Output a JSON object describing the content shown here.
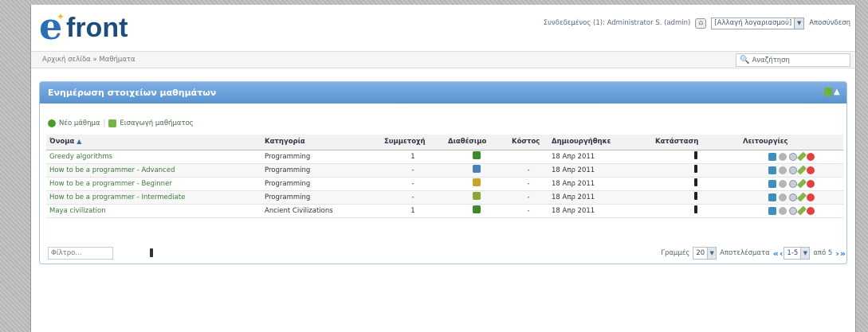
{
  "header": {
    "logo": "efront",
    "user": {
      "connected_label": "Συνδεδεμένος (1): Administrator S. (admin)",
      "role_switch": "[Αλλαγή λογαριασμού]",
      "logout": "Αποσύνδεση"
    }
  },
  "nav": {
    "breadcrumb": "Αρχική σελίδα » Μαθήματα",
    "search_placeholder": "Αναζήτηση"
  },
  "panel": {
    "title": "Ενημέρωση στοιχείων μαθημάτων",
    "toolbar": {
      "new_course": "Νέο μάθημα",
      "import_course": "Εισαγωγή μαθήματος"
    },
    "columns": [
      "Όνομα",
      "Κατηγορία",
      "Συμμετοχή",
      "Διαθέσιμο",
      "Κόστος",
      "Δημιουργήθηκε",
      "Κατάσταση",
      "Λειτουργίες"
    ],
    "rows": [
      {
        "name": "Greedy algorithms",
        "category": "Programming",
        "participation": "1",
        "available_color": "#3c8a2a",
        "cost": "",
        "created": "18 Απρ 2011"
      },
      {
        "name": "How to be a programmer - Advanced",
        "category": "Programming",
        "participation": "-",
        "available_color": "#4a7fb8",
        "cost": "-",
        "created": "18 Απρ 2011"
      },
      {
        "name": "How to be a programmer - Beginner",
        "category": "Programming",
        "participation": "-",
        "available_color": "#c9a42a",
        "cost": "-",
        "created": "18 Απρ 2011"
      },
      {
        "name": "How to be a programmer - Intermediate",
        "category": "Programming",
        "participation": "-",
        "available_color": "#8aa83a",
        "cost": "-",
        "created": "18 Απρ 2011"
      },
      {
        "name": "Maya civilization",
        "category": "Ancient Civilizations",
        "participation": "1",
        "available_color": "#3c8a2a",
        "cost": "-",
        "created": "18 Απρ 2011"
      }
    ],
    "footer": {
      "filter_placeholder": "Φίλτρο...",
      "rows_label": "Γραμμές",
      "rows_value": "20",
      "results_label": "Αποτελέσματα",
      "range_value": "1-5",
      "of_label": "από 5"
    }
  },
  "colors": {
    "panel_header": "#5a92cf",
    "link_green": "#3a7a3a",
    "logo_blue": "#1e4d7b"
  }
}
